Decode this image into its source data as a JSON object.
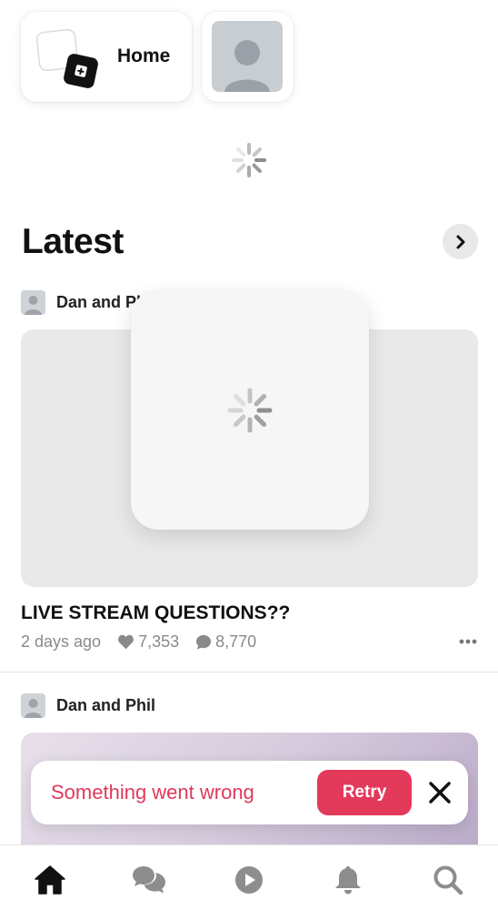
{
  "top_tiles": {
    "home_label": "Home"
  },
  "latest": {
    "title": "Latest"
  },
  "posts": [
    {
      "author": "Dan and Phil",
      "title": "LIVE STREAM QUESTIONS??",
      "age": "2 days ago",
      "likes": "7,353",
      "comments": "8,770"
    },
    {
      "author": "Dan and Phil"
    }
  ],
  "toast": {
    "message": "Something went wrong",
    "retry_label": "Retry"
  },
  "bottom_nav": {
    "items": [
      "home-icon",
      "chat-icon",
      "play-icon",
      "bell-icon",
      "search-icon"
    ],
    "active": "home-icon"
  },
  "colors": {
    "error_text": "#e0385b",
    "retry_bg": "#e33a5b",
    "text_primary": "#111111",
    "text_muted": "#8a8a8a"
  }
}
